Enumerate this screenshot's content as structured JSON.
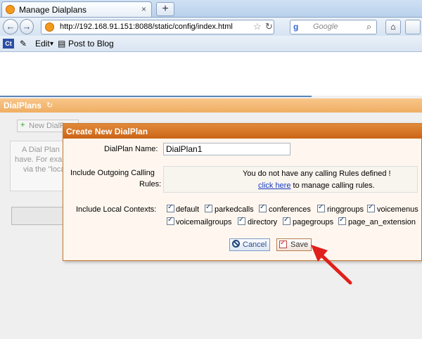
{
  "browser": {
    "tab_title": "Manage Dialplans",
    "tab_close": "×",
    "new_tab": "+",
    "url": "http://192.168.91.151:8088/static/config/index.html",
    "search_engine_glyph": "g",
    "search_placeholder": "Google",
    "bookmarks": {
      "ct_label": "Ct",
      "edit": "Edit",
      "edit_arrow": "▾",
      "post": "Post to Blog"
    }
  },
  "page": {
    "section_title": "DialPlans",
    "refresh_glyph": "↻",
    "new_button": "New DialP",
    "info_lines": [
      "A Dial Plan",
      "have. For exa",
      "via the \"loca"
    ]
  },
  "dialog": {
    "title": "Create New DialPlan",
    "name_label": "DialPlan Name:",
    "name_value": "DialPlan1",
    "rules_label_1": "Include Outgoing Calling",
    "rules_label_2": "Rules:",
    "rules_message": "You do not have any calling Rules defined !",
    "rules_link": "click here",
    "rules_link_suffix": " to manage calling rules.",
    "contexts_label": "Include Local Contexts:",
    "contexts": [
      "default",
      "parkedcalls",
      "conferences",
      "ringgroups",
      "voicemenus",
      "voicemailgroups",
      "directory",
      "pagegroups",
      "page_an_extension"
    ],
    "cancel_label": "Cancel",
    "save_label": "Save"
  },
  "colors": {
    "header_orange": "#efae63",
    "dialog_title": "#cc6416",
    "arrow_red": "#e0201c",
    "link_blue": "#1a3cc2"
  }
}
